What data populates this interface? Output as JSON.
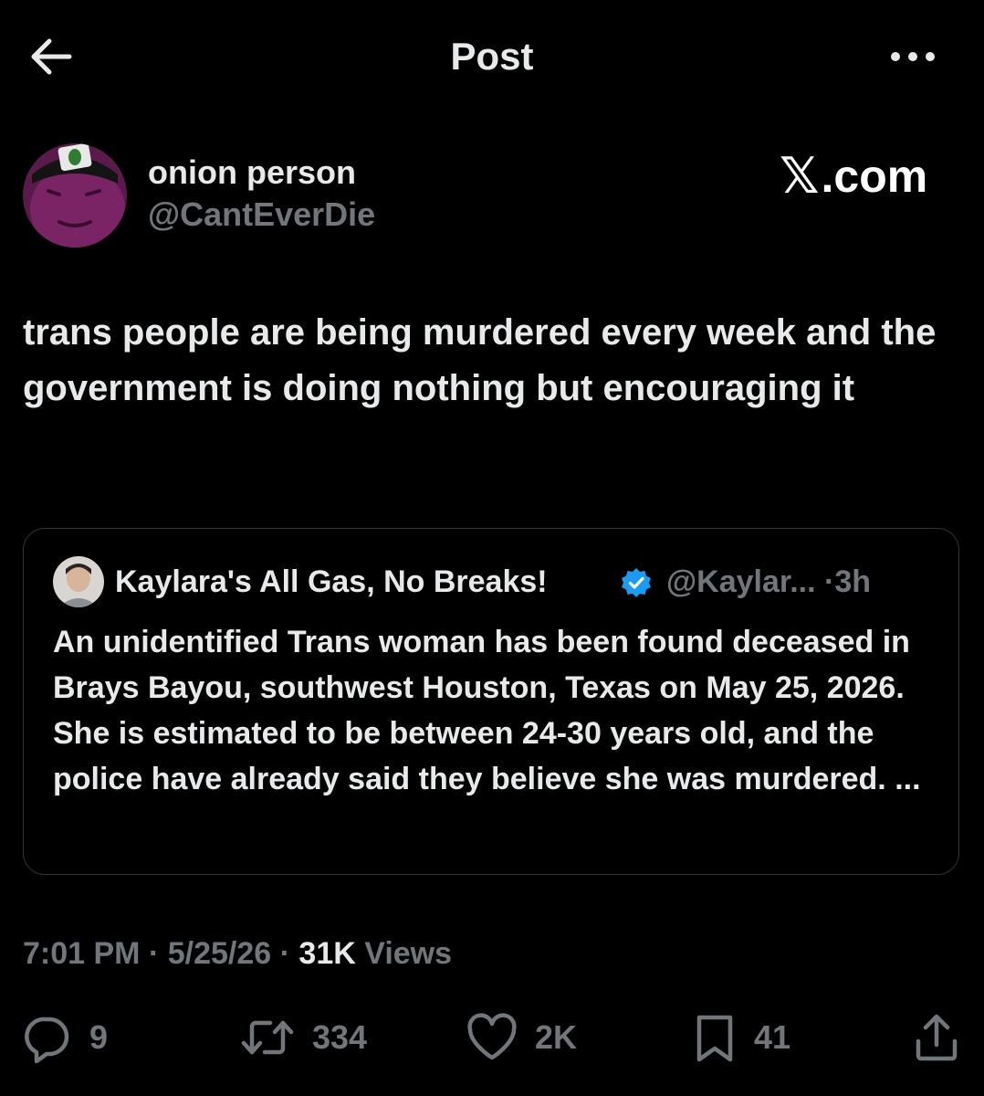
{
  "header": {
    "title": "Post"
  },
  "author": {
    "name": "onion person",
    "handle": "@CantEverDie",
    "watermark": ".com",
    "watermark_glyph": "𝕏"
  },
  "post": {
    "text": "trans people are being murdered every week and the government is doing nothing but encouraging it"
  },
  "quoted_post": {
    "author_name": "Kaylara's All Gas, No Breaks!",
    "handle": "@Kaylar...",
    "separator": "·",
    "age": "3h",
    "text": "An unidentified Trans woman has been found deceased in Brays Bayou, southwest Houston, Texas on May 25, 2026. She is estimated to be between 24-30 years old, and the police have already said they believe she was murdered. ..."
  },
  "meta": {
    "time": "7:01 PM",
    "date": "5/25/26",
    "separator": "·",
    "views_count": "31K",
    "views_label": "Views"
  },
  "actions": {
    "replies": "9",
    "reposts": "334",
    "likes": "2K",
    "bookmarks": "41"
  },
  "icons": {
    "back": "arrow-left-icon",
    "more": "more-horizontal-icon",
    "reply": "reply-bubble-icon",
    "repost": "repost-icon",
    "like": "heart-icon",
    "bookmark": "bookmark-icon",
    "share": "share-icon",
    "verified": "verified-badge-icon"
  },
  "colors": {
    "background": "#000000",
    "text": "#e7e9ea",
    "muted": "#71767b",
    "border": "#2f3336",
    "verified": "#1d9bf0"
  }
}
